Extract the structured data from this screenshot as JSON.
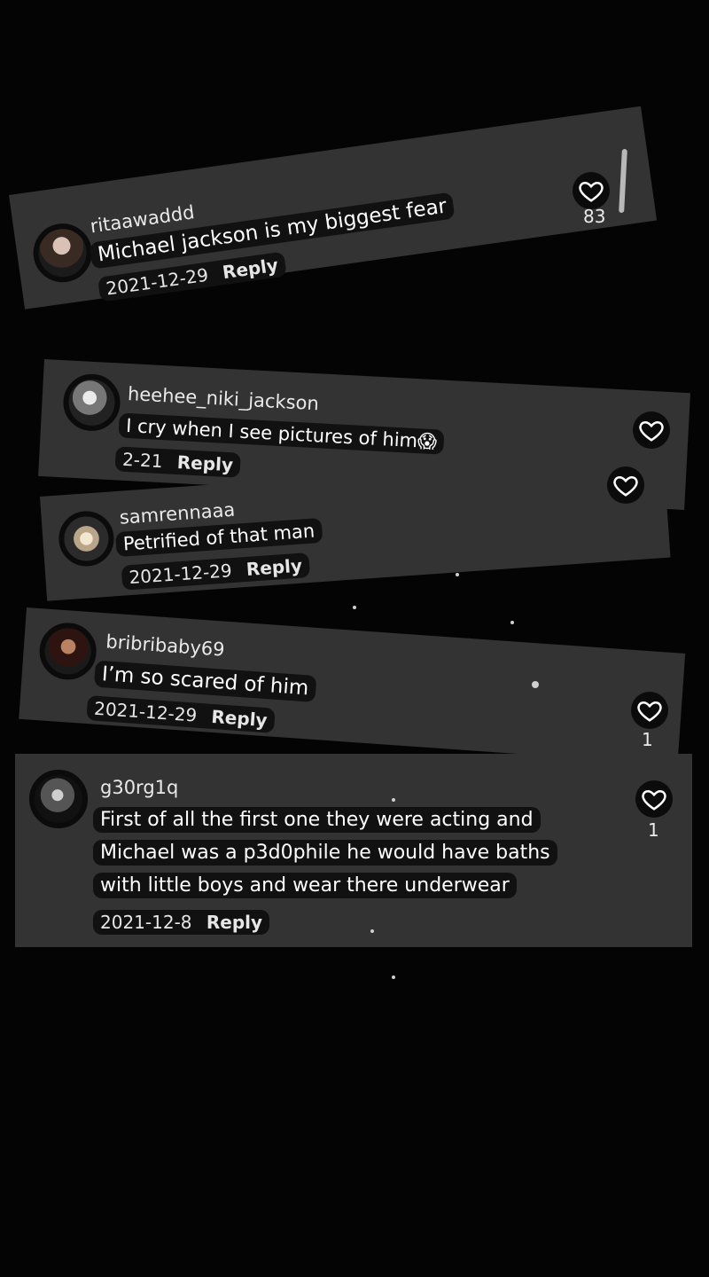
{
  "comments": [
    {
      "username": "ritaawaddd",
      "text": "Michael jackson is my biggest fear",
      "date": "2021-12-29",
      "reply": "Reply",
      "likes": "83"
    },
    {
      "username": "heehee_niki_jackson",
      "text": "I cry when I see pictures of him😱",
      "date": "2-21",
      "reply": "Reply",
      "likes": ""
    },
    {
      "username": "samrennaaa",
      "text": "Petrified of that man",
      "date": "2021-12-29",
      "reply": "Reply",
      "likes": ""
    },
    {
      "username": "bribribaby69",
      "text": "I’m so scared of him",
      "date": "2021-12-29",
      "reply": "Reply",
      "likes": "1"
    },
    {
      "username": "g30rg1q",
      "text_lines": [
        "First of all the first one they were acting and",
        "Michael was a p3d0phile he would have baths",
        "with little boys and wear there underwear"
      ],
      "date": "2021-12-8",
      "reply": "Reply",
      "likes": "1"
    }
  ]
}
